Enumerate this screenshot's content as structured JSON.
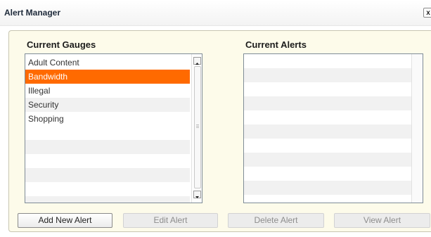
{
  "window": {
    "title": "Alert Manager",
    "close_label": "x"
  },
  "gauges": {
    "title": "Current Gauges",
    "items": [
      "Adult Content",
      "Bandwidth",
      "Illegal",
      "Security",
      "Shopping"
    ],
    "selected": "Bandwidth"
  },
  "alerts": {
    "title": "Current Alerts",
    "items": []
  },
  "buttons": {
    "add": "Add New Alert",
    "edit": "Edit Alert",
    "delete": "Delete Alert",
    "view": "View Alert"
  },
  "colors": {
    "selection": "#ff6a00",
    "panel_bg": "#fdfbea"
  }
}
